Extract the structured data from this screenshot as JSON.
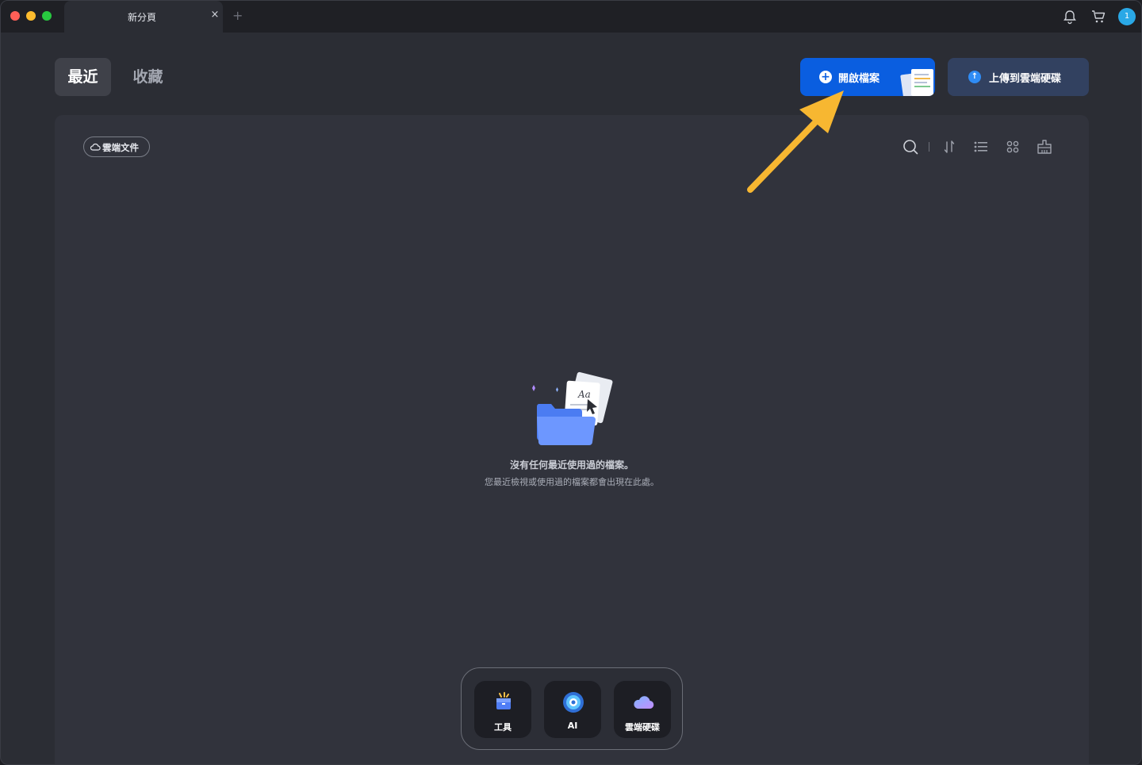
{
  "window": {
    "tab_title": "新分頁",
    "tab_close": "×",
    "tab_add": "+",
    "notification_count": "1"
  },
  "header": {
    "segment_recent": "最近",
    "segment_favorites": "收藏",
    "open_file_label": "開啟檔案",
    "upload_label": "上傳到雲端硬碟"
  },
  "toolbar": {
    "cloud_docs_label": "雲端文件",
    "icons": [
      "search-icon",
      "sort-icon",
      "list-view-icon",
      "grid-view-icon",
      "clear-history-icon"
    ]
  },
  "empty_state": {
    "title": "沒有任何最近使用過的檔案。",
    "subtitle": "您最近檢視或使用過的檔案都會出現在此處。"
  },
  "dock": {
    "items": [
      {
        "label": "工具",
        "icon": "toolbox-icon"
      },
      {
        "label": "AI",
        "icon": "ai-orb-icon"
      },
      {
        "label": "雲端硬碟",
        "icon": "cloud-drive-icon"
      }
    ]
  },
  "colors": {
    "accent": "#0a5ee0",
    "upload_bg": "#324160",
    "panel_bg": "#31333c",
    "window_bg": "#2b2d34",
    "arrow": "#f7b731"
  }
}
